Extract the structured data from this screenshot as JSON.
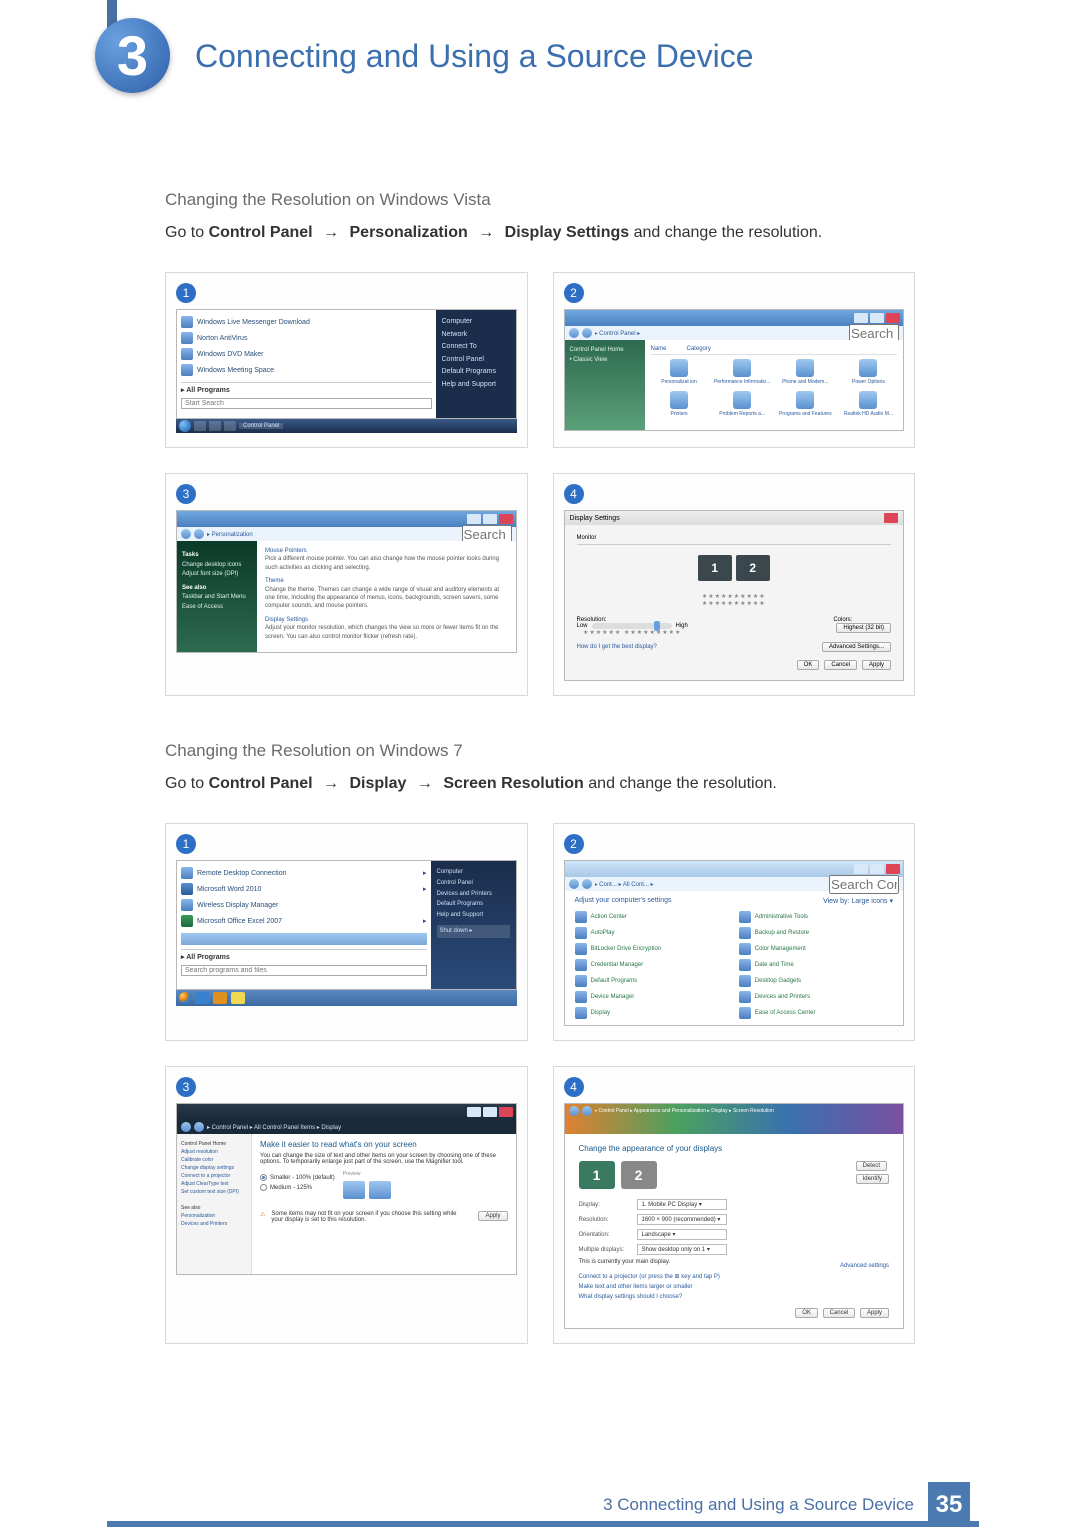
{
  "chapter": {
    "number": "3",
    "title": "Connecting and Using a Source Device"
  },
  "vista": {
    "heading": "Changing the Resolution on Windows Vista",
    "instr_pre": "Go to ",
    "path1": "Control Panel",
    "path2": "Personalization",
    "path3": "Display Settings",
    "instr_post": " and change the resolution.",
    "shot1": {
      "num": "1",
      "items": [
        "Windows Live Messenger Download",
        "Norton AntiVirus",
        "Windows DVD Maker",
        "Windows Meeting Space"
      ],
      "all_programs": "All Programs",
      "search_ph": "Start Search",
      "right": [
        "Computer",
        "Network",
        "Connect To",
        "Control Panel",
        "Default Programs",
        "Help and Support"
      ],
      "taskbar_label": "Control Panel"
    },
    "shot2": {
      "num": "2",
      "breadcrumb": "▸ Control Panel ▸",
      "search_ph": "Search",
      "side": [
        "Control Panel Home",
        "Classic View"
      ],
      "headers": [
        "Name",
        "Category"
      ],
      "icons": [
        "Personalizat ion",
        "Performance Informatio...",
        "Phone and Modem...",
        "Power Options",
        "Printers",
        "Problem Reports a...",
        "Programs and Features",
        "Realtek HD Audio M..."
      ]
    },
    "shot3": {
      "num": "3",
      "breadcrumb": "▸ Personalization",
      "search_ph": "Search",
      "side_tasks": "Tasks",
      "side_items": [
        "Change desktop icons",
        "Adjust font size (DPI)"
      ],
      "side_see": "See also",
      "side_see_items": [
        "Taskbar and Start Menu",
        "Ease of Access"
      ],
      "main": [
        {
          "t": "Mouse Pointers",
          "d": "Pick a different mouse pointer. You can also change how the mouse pointer looks during such activities as clicking and selecting."
        },
        {
          "t": "Theme",
          "d": "Change the theme. Themes can change a wide range of visual and auditory elements at one time, including the appearance of menus, icons, backgrounds, screen savers, some computer sounds, and mouse pointers."
        },
        {
          "t": "Display Settings",
          "d": "Adjust your monitor resolution, which changes the view so more or fewer items fit on the screen. You can also control monitor flicker (refresh rate)."
        }
      ]
    },
    "shot4": {
      "num": "4",
      "title": "Display Settings",
      "tab": "Monitor",
      "mon1": "1",
      "mon2": "2",
      "res_label": "Resolution:",
      "low": "Low",
      "high": "High",
      "colors_label": "Colors:",
      "colors_val": "Highest (32 bit)",
      "help_link": "How do I get the best display?",
      "adv": "Advanced Settings...",
      "ok": "OK",
      "cancel": "Cancel",
      "apply": "Apply"
    }
  },
  "win7": {
    "heading": "Changing the Resolution on Windows 7",
    "instr_pre": "Go to ",
    "path1": "Control Panel",
    "path2": "Display",
    "path3": "Screen Resolution",
    "instr_post": " and change the resolution.",
    "shot1": {
      "num": "1",
      "items": [
        "Remote Desktop Connection",
        "Microsoft Word 2010",
        "Wireless Display Manager",
        "Microsoft Office Excel 2007"
      ],
      "all_programs": "All Programs",
      "search_ph": "Search programs and files",
      "right": [
        "Computer",
        "Control Panel",
        "Devices and Printers",
        "Default Programs",
        "Help and Support",
        "Shut down ▸"
      ]
    },
    "shot2": {
      "num": "2",
      "breadcrumb": "▸ Cont... ▸ All Cont... ▸",
      "search_ph": "Search Control Panel",
      "top": "Adjust your computer's settings",
      "view": "View by: Large icons ▾",
      "items": [
        "Action Center",
        "Administrative Tools",
        "AutoPlay",
        "Backup and Restore",
        "BitLocker Drive Encryption",
        "Color Management",
        "Credential Manager",
        "Date and Time",
        "Default Programs",
        "Desktop Gadgets",
        "Device Manager",
        "Devices and Printers",
        "Display",
        "Ease of Access Center"
      ]
    },
    "shot3": {
      "num": "3",
      "breadcrumb": "▸ Control Panel ▸ All Control Panel Items ▸ Display",
      "side_hd": "Control Panel Home",
      "side": [
        "Adjust resolution",
        "Calibrate color",
        "Change display settings",
        "Connect to a projector",
        "Adjust ClearType text",
        "Set custom text size (DPI)"
      ],
      "side_see": "See also",
      "side_see_items": [
        "Personalization",
        "Devices and Printers"
      ],
      "hd": "Make it easier to read what's on your screen",
      "desc": "You can change the size of text and other items on your screen by choosing one of these options. To temporarily enlarge just part of the screen, use the Magnifier tool.",
      "opt1": "Smaller - 100% (default)",
      "opt2": "Medium - 125%",
      "note": "Some items may not fit on your screen if you choose this setting while your display is set to this resolution.",
      "apply": "Apply",
      "preview": "Preview"
    },
    "shot4": {
      "num": "4",
      "breadcrumb": "▸ Control Panel ▸ Appearance and Personalization ▸ Display ▸ Screen Resolution",
      "hd": "Change the appearance of your displays",
      "detect": "Detect",
      "identify": "Identify",
      "mon1": "1",
      "mon2": "2",
      "f_display": "Display:",
      "f_display_v": "1. Mobile PC Display ▾",
      "f_res": "Resolution:",
      "f_res_v": "1600 × 900 (recommended) ▾",
      "f_orient": "Orientation:",
      "f_orient_v": "Landscape ▾",
      "f_multi": "Multiple displays:",
      "f_multi_v": "Show desktop only on 1 ▾",
      "curr": "This is currently your main display.",
      "adv": "Advanced settings",
      "proj": "Connect to a projector (or press the ⊞ key and tap P)",
      "link1": "Make text and other items larger or smaller",
      "link2": "What display settings should I choose?",
      "ok": "OK",
      "cancel": "Cancel",
      "apply": "Apply"
    }
  },
  "arrow": "→",
  "footer": {
    "text": "3 Connecting and Using a Source Device",
    "page": "35"
  }
}
